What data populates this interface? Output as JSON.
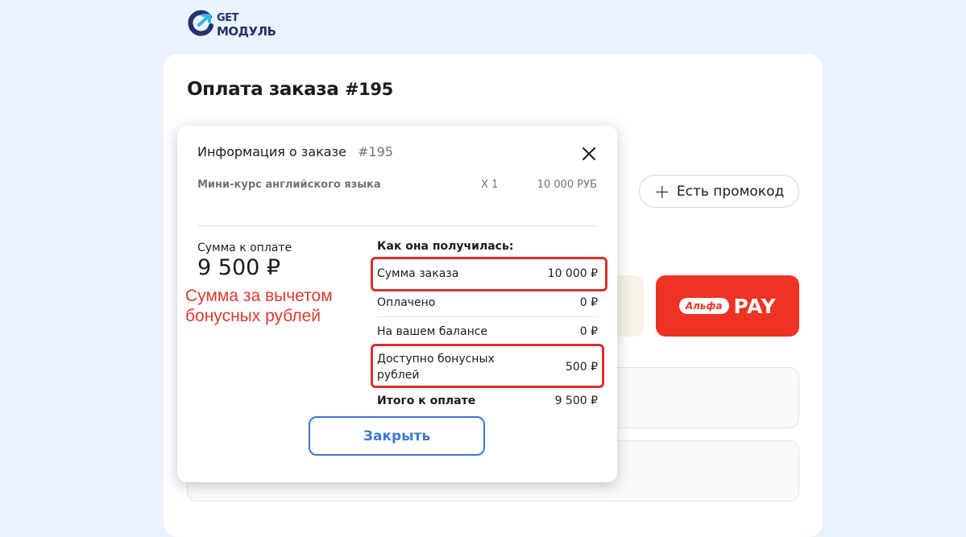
{
  "logo": {
    "line1": "GET",
    "line2": "МОДУЛЬ"
  },
  "page": {
    "title": "Оплата заказа",
    "order_number": "#195"
  },
  "promo": {
    "label": "Есть промокод"
  },
  "alfa_pay": {
    "pill": "Альфа",
    "label": "PAY"
  },
  "modal": {
    "title": "Информация о заказе",
    "order_number": "#195",
    "item": {
      "name": "Мини-курс английского языка",
      "qty": "X 1",
      "price": "10 000 РУБ"
    },
    "sum_label": "Сумма к оплате",
    "sum_value": "9 500 ₽",
    "annotation": "Сумма за вычетом бонусных рублей",
    "breakdown": {
      "title": "Как она получилась:",
      "rows": [
        {
          "label": "Сумма заказа",
          "value": "10 000 ₽"
        },
        {
          "label": "Оплачено",
          "value": "0 ₽"
        },
        {
          "label": "На вашем балансе",
          "value": "0 ₽"
        },
        {
          "label": "Доступно бонусных рублей",
          "value": "500 ₽"
        },
        {
          "label": "Итого к оплате",
          "value": "9 500 ₽"
        }
      ]
    },
    "close_button": "Закрыть"
  },
  "colors": {
    "accent": "#3a79d2",
    "highlight": "#d8312a",
    "alfa_red": "#ee3224",
    "logo_navy": "#24336b"
  }
}
